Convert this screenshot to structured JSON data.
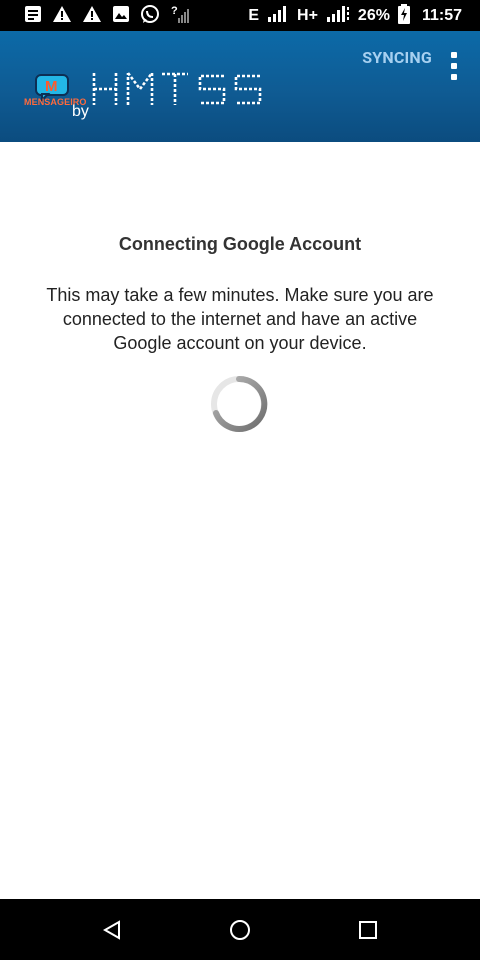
{
  "status_bar": {
    "network_label": "E",
    "hplus_label": "H+",
    "battery_percent": "26%",
    "time": "11:57",
    "icons": [
      "notes-icon",
      "warning-icon",
      "warning-icon",
      "image-icon",
      "whatsapp-icon",
      "no-signal-icon",
      "signal-icon",
      "signal-icon",
      "battery-charging-icon"
    ]
  },
  "toolbar": {
    "action_label": "SYNCING",
    "logo": {
      "brand_small": "MENSAGEIRO",
      "by_label": "by",
      "wordmark": "HMTSS"
    },
    "colors": {
      "gradient_top": "#0c6aa8",
      "gradient_bottom": "#0b4c7f",
      "action_text": "#a7d0f0"
    }
  },
  "content": {
    "title": "Connecting Google Account",
    "description": "This may take a few minutes. Make sure you are connected to the internet and have an active Google account on your device."
  },
  "navigation": {
    "buttons": [
      "back-icon",
      "home-icon",
      "recents-icon"
    ]
  }
}
